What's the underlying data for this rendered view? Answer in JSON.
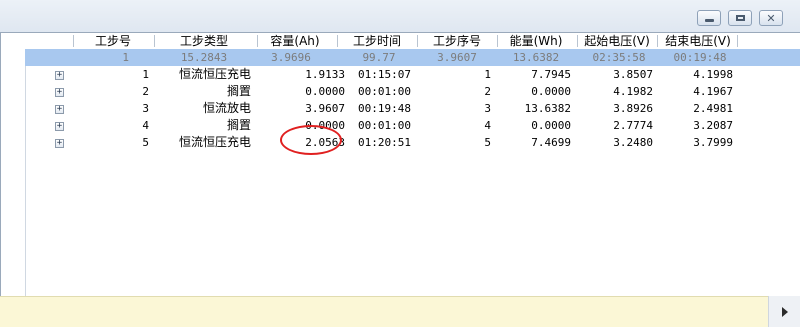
{
  "window": {
    "controls": {
      "minimize": "minimize",
      "maximize": "maximize",
      "close": "✕"
    }
  },
  "table": {
    "columns": [
      "工步号",
      "工步类型",
      "容量(Ah)",
      "工步时间",
      "工步序号",
      "能量(Wh)",
      "起始电压(V)",
      "结束电压(V)"
    ],
    "summary_row": {
      "expander": "−",
      "step_no": "1",
      "type": "15.2843",
      "capacity": "3.9696",
      "time": "99.77",
      "seq": "3.9607",
      "energy": "13.6382",
      "start_v": "02:35:58",
      "end_v": "00:19:48"
    },
    "rows": [
      {
        "expander": "+",
        "step_no": "1",
        "type": "恒流恒压充电",
        "capacity": "1.9133",
        "time": "01:15:07",
        "seq": "1",
        "energy": "7.7945",
        "start_v": "3.8507",
        "end_v": "4.1998"
      },
      {
        "expander": "+",
        "step_no": "2",
        "type": "搁置",
        "capacity": "0.0000",
        "time": "00:01:00",
        "seq": "2",
        "energy": "0.0000",
        "start_v": "4.1982",
        "end_v": "4.1967"
      },
      {
        "expander": "+",
        "step_no": "3",
        "type": "恒流放电",
        "capacity": "3.9607",
        "time": "00:19:48",
        "seq": "3",
        "energy": "13.6382",
        "start_v": "3.8926",
        "end_v": "2.4981"
      },
      {
        "expander": "+",
        "step_no": "4",
        "type": "搁置",
        "capacity": "0.0000",
        "time": "00:01:00",
        "seq": "4",
        "energy": "0.0000",
        "start_v": "2.7774",
        "end_v": "3.2087"
      },
      {
        "expander": "+",
        "step_no": "5",
        "type": "恒流恒压充电",
        "capacity": "2.0563",
        "time": "01:20:51",
        "seq": "5",
        "energy": "7.4699",
        "start_v": "3.2480",
        "end_v": "3.7999"
      }
    ]
  },
  "colors": {
    "selected_row": "#a8c8ef",
    "annotation": "#e02020",
    "status_bar": "#fbf7d6"
  },
  "icons": {
    "scroll_right": "arrow-right-icon"
  }
}
